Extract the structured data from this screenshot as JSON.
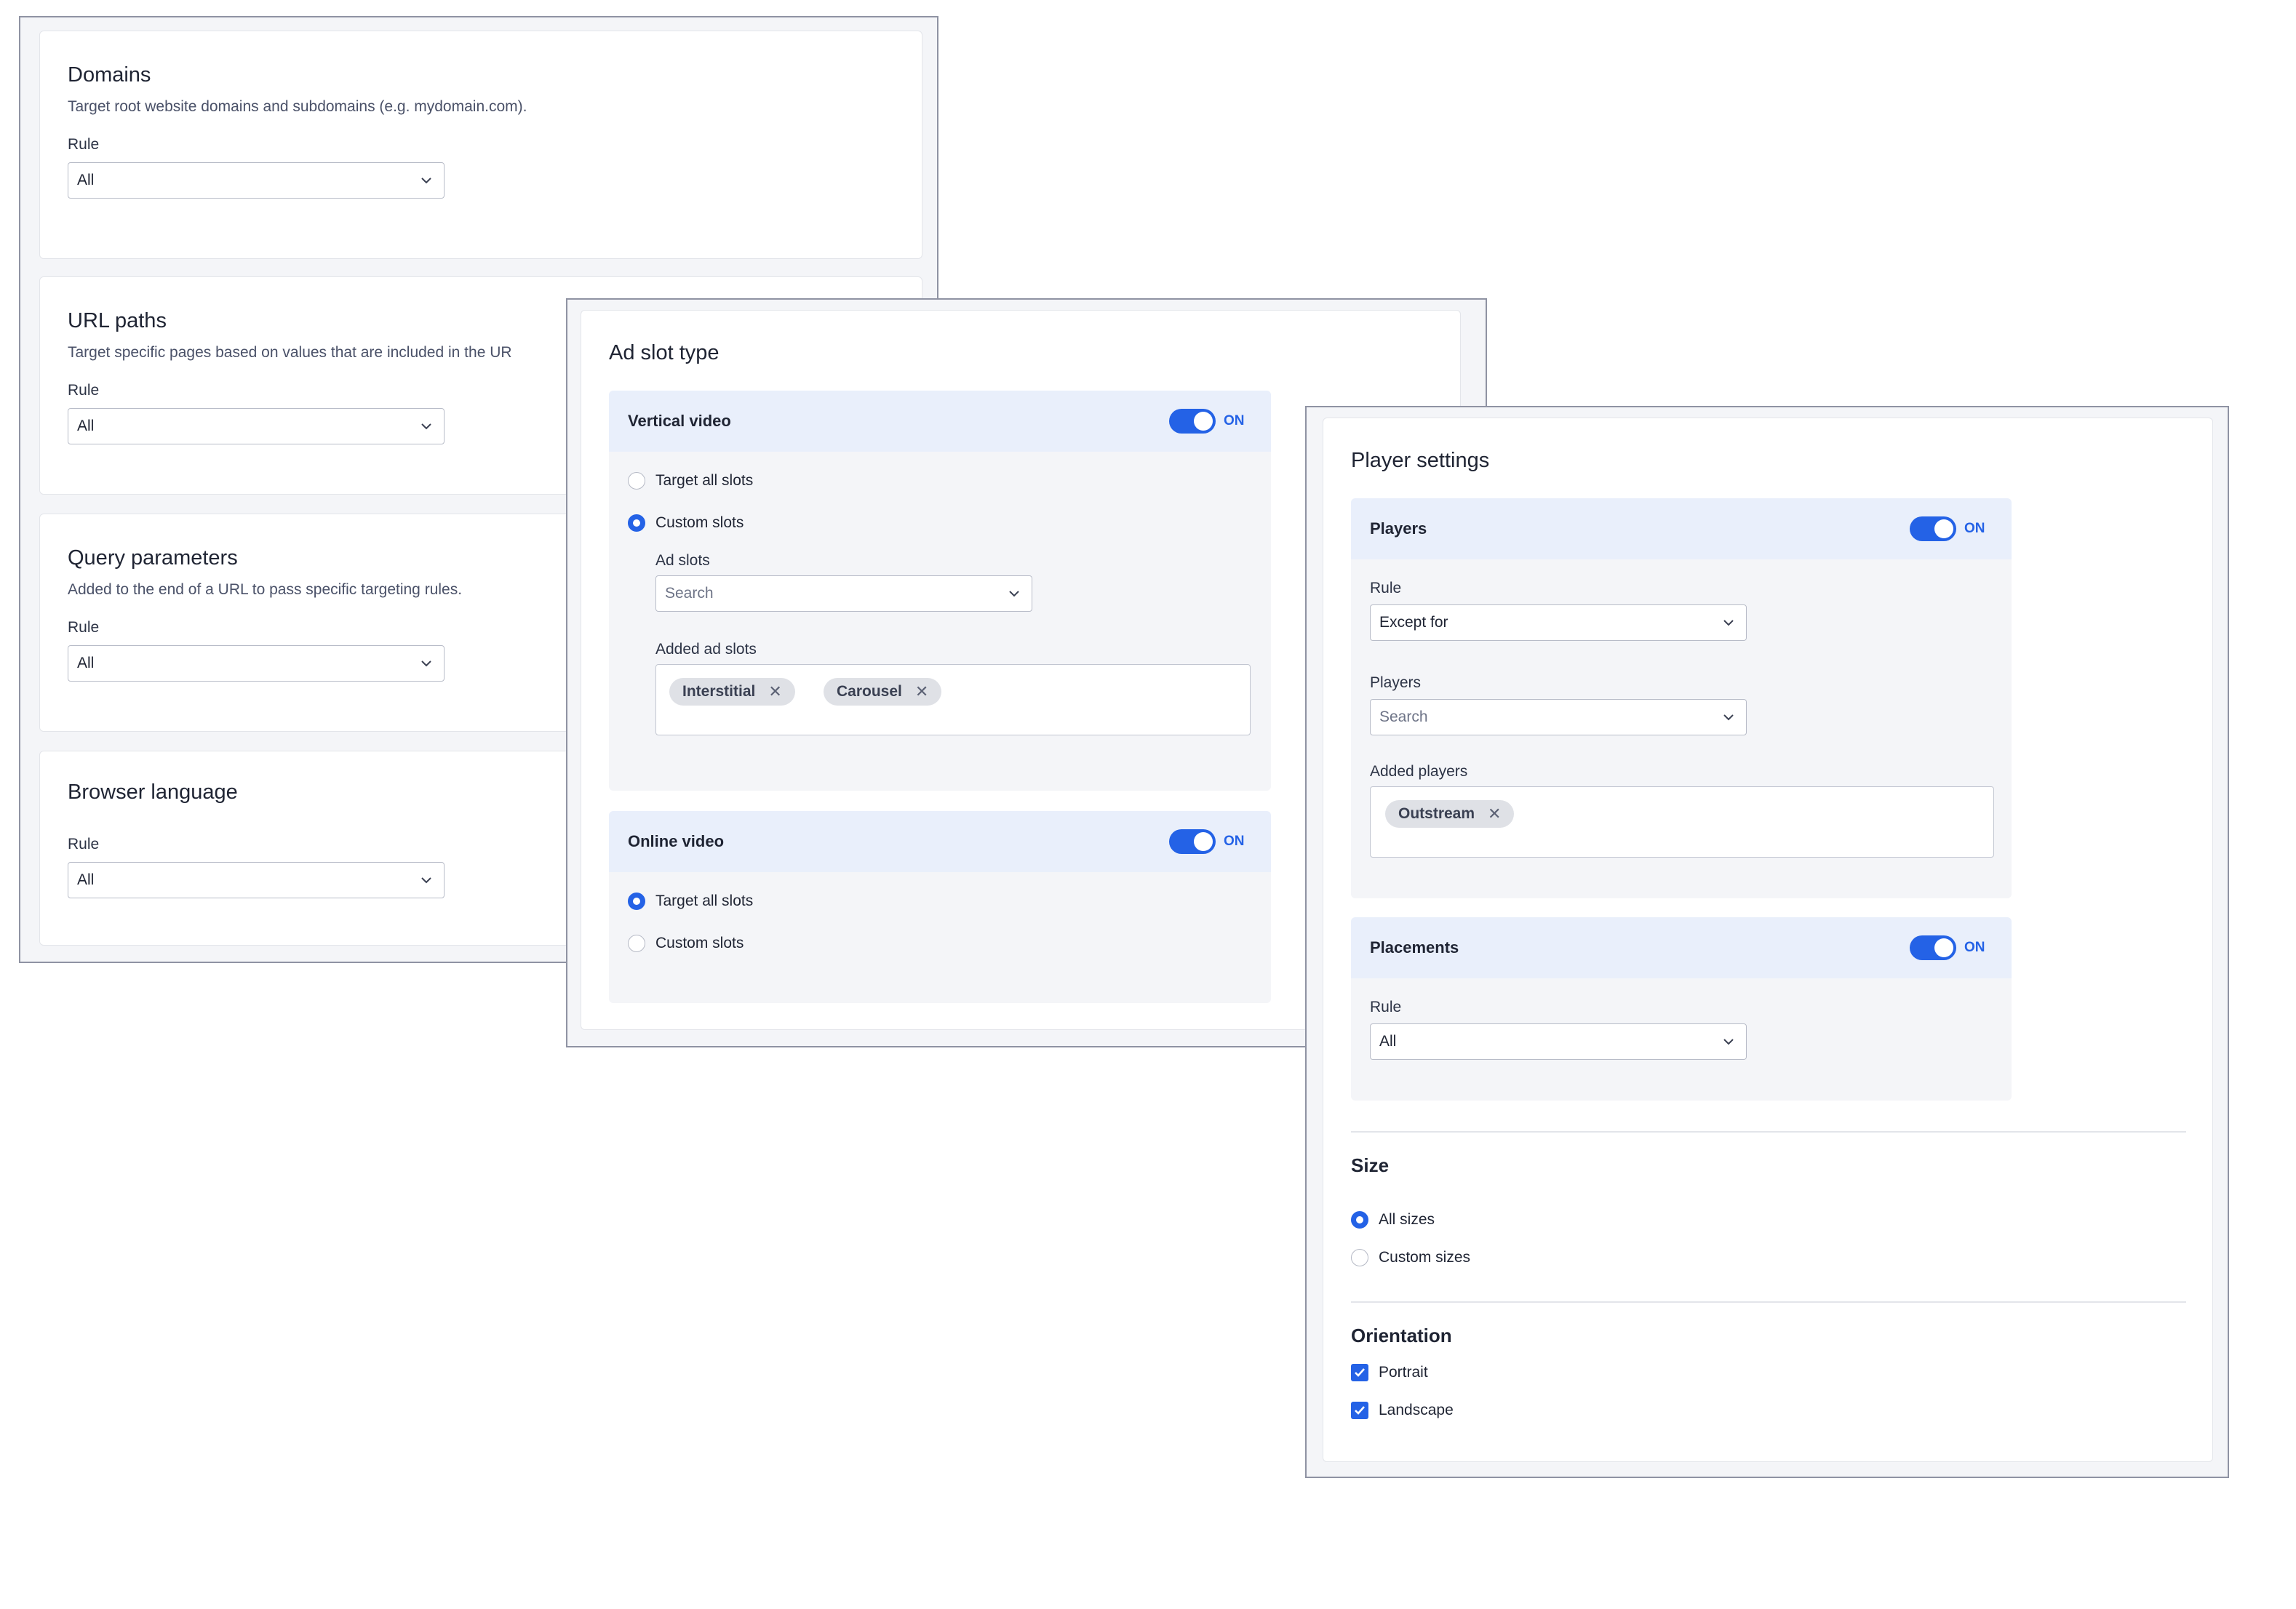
{
  "targeting": {
    "domains": {
      "title": "Domains",
      "description": "Target root website domains and subdomains (e.g. mydomain.com).",
      "rule_label": "Rule",
      "rule_value": "All"
    },
    "url_paths": {
      "title": "URL paths",
      "description": "Target specific pages based on values that are included in the UR",
      "rule_label": "Rule",
      "rule_value": "All"
    },
    "query_parameters": {
      "title": "Query parameters",
      "description": "Added to the end of a URL to pass specific targeting rules.",
      "rule_label": "Rule",
      "rule_value": "All"
    },
    "browser_language": {
      "title": "Browser language",
      "rule_label": "Rule",
      "rule_value": "All"
    }
  },
  "ad_slot_type": {
    "title": "Ad slot type",
    "vertical_video": {
      "title": "Vertical video",
      "toggle_text": "ON",
      "toggle_on": true,
      "options": [
        {
          "label": "Target all slots",
          "checked": false
        },
        {
          "label": "Custom slots",
          "checked": true
        }
      ],
      "ad_slots_label": "Ad slots",
      "search_placeholder": "Search",
      "added_label": "Added ad slots",
      "chips": [
        "Interstitial",
        "Carousel"
      ]
    },
    "online_video": {
      "title": "Online video",
      "toggle_text": "ON",
      "toggle_on": true,
      "options": [
        {
          "label": "Target all slots",
          "checked": true
        },
        {
          "label": "Custom slots",
          "checked": false
        }
      ]
    }
  },
  "player_settings": {
    "title": "Player settings",
    "players": {
      "title": "Players",
      "toggle_text": "ON",
      "toggle_on": true,
      "rule_label": "Rule",
      "rule_value": "Except for",
      "players_label": "Players",
      "search_placeholder": "Search",
      "added_label": "Added players",
      "chips": [
        "Outstream"
      ]
    },
    "placements": {
      "title": "Placements",
      "toggle_text": "ON",
      "toggle_on": true,
      "rule_label": "Rule",
      "rule_value": "All"
    },
    "size": {
      "title": "Size",
      "options": [
        {
          "label": "All sizes",
          "checked": true
        },
        {
          "label": "Custom sizes",
          "checked": false
        }
      ]
    },
    "orientation": {
      "title": "Orientation",
      "options": [
        {
          "label": "Portrait",
          "checked": true
        },
        {
          "label": "Landscape",
          "checked": true
        }
      ]
    }
  },
  "colors": {
    "accent": "#2462e6",
    "section_header": "#e9effb",
    "panel_background": "#f4f5f8",
    "chip_background": "#dfe1e6"
  }
}
